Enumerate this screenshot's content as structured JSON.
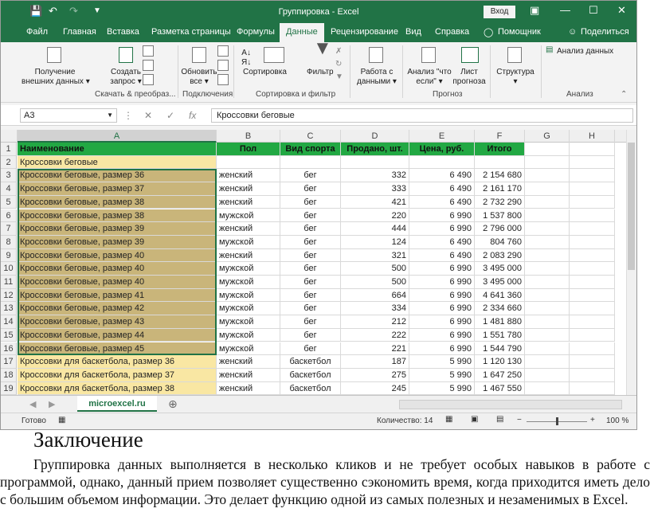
{
  "window": {
    "title": "Группировка  -  Excel",
    "sign_in": "Вход",
    "minimize": "—",
    "restore": "☐",
    "close": "✕"
  },
  "tabs": [
    "Файл",
    "Главная",
    "Вставка",
    "Разметка страницы",
    "Формулы",
    "Данные",
    "Рецензирование",
    "Вид",
    "Справка",
    "Помощник",
    "Поделиться"
  ],
  "active_tab": "Данные",
  "ribbon": {
    "get_data": [
      "Получение",
      "внешних данных ▾"
    ],
    "create_query": [
      "Создать",
      "запрос ▾"
    ],
    "refresh": [
      "Обновить",
      "все ▾"
    ],
    "sort": "Сортировка",
    "filter": "Фильтр",
    "forecast_tools": [
      "Работа с",
      "данными ▾"
    ],
    "what_if": [
      "Анализ \"что",
      "если\" ▾"
    ],
    "forecast_sheet": [
      "Лист",
      "прогноза"
    ],
    "outline": [
      "Структура",
      "▾"
    ],
    "data_analysis": "Анализ данных",
    "groups": [
      "Скачать & преобраз...",
      "Подключения",
      "Сортировка и фильтр",
      "Прогноз",
      "Анализ"
    ]
  },
  "formula_bar": {
    "name_box": "A3",
    "fx": "fx",
    "value": "Кроссовки беговые"
  },
  "columns": [
    "A",
    "B",
    "C",
    "D",
    "E",
    "F",
    "G",
    "H"
  ],
  "rows": [
    {
      "n": "1",
      "a": "Наименование",
      "b": "Пол",
      "c": "Вид спорта",
      "d": "Продано, шт.",
      "e": "Цена, руб.",
      "f": "Итого",
      "type": "header"
    },
    {
      "n": "2",
      "a": "Кроссовки беговые",
      "b": "",
      "c": "",
      "d": "",
      "e": "",
      "f": "",
      "type": "group"
    },
    {
      "n": "3",
      "a": "Кроссовки беговые, размер 36",
      "b": "женский",
      "c": "бег",
      "d": "332",
      "e": "6 490",
      "f": "2 154 680",
      "type": "sel"
    },
    {
      "n": "4",
      "a": "Кроссовки беговые, размер 37",
      "b": "женский",
      "c": "бег",
      "d": "333",
      "e": "6 490",
      "f": "2 161 170",
      "type": "sel"
    },
    {
      "n": "5",
      "a": "Кроссовки беговые, размер 38",
      "b": "женский",
      "c": "бег",
      "d": "421",
      "e": "6 490",
      "f": "2 732 290",
      "type": "sel"
    },
    {
      "n": "6",
      "a": "Кроссовки беговые, размер 38",
      "b": "мужской",
      "c": "бег",
      "d": "220",
      "e": "6 990",
      "f": "1 537 800",
      "type": "sel"
    },
    {
      "n": "7",
      "a": "Кроссовки беговые, размер 39",
      "b": "женский",
      "c": "бег",
      "d": "444",
      "e": "6 990",
      "f": "2 796 000",
      "type": "sel"
    },
    {
      "n": "8",
      "a": "Кроссовки беговые, размер 39",
      "b": "мужской",
      "c": "бег",
      "d": "124",
      "e": "6 490",
      "f": "804 760",
      "type": "sel"
    },
    {
      "n": "9",
      "a": "Кроссовки беговые, размер 40",
      "b": "женский",
      "c": "бег",
      "d": "321",
      "e": "6 490",
      "f": "2 083 290",
      "type": "sel"
    },
    {
      "n": "10",
      "a": "Кроссовки беговые, размер 40",
      "b": "мужской",
      "c": "бег",
      "d": "500",
      "e": "6 990",
      "f": "3 495 000",
      "type": "sel"
    },
    {
      "n": "11",
      "a": "Кроссовки беговые, размер 40",
      "b": "мужской",
      "c": "бег",
      "d": "500",
      "e": "6 990",
      "f": "3 495 000",
      "type": "sel"
    },
    {
      "n": "12",
      "a": "Кроссовки беговые, размер 41",
      "b": "мужской",
      "c": "бег",
      "d": "664",
      "e": "6 990",
      "f": "4 641 360",
      "type": "sel"
    },
    {
      "n": "13",
      "a": "Кроссовки беговые, размер 42",
      "b": "мужской",
      "c": "бег",
      "d": "334",
      "e": "6 990",
      "f": "2 334 660",
      "type": "sel"
    },
    {
      "n": "14",
      "a": "Кроссовки беговые, размер 43",
      "b": "мужской",
      "c": "бег",
      "d": "212",
      "e": "6 990",
      "f": "1 481 880",
      "type": "sel"
    },
    {
      "n": "15",
      "a": "Кроссовки беговые, размер 44",
      "b": "мужской",
      "c": "бег",
      "d": "222",
      "e": "6 990",
      "f": "1 551 780",
      "type": "sel"
    },
    {
      "n": "16",
      "a": "Кроссовки беговые, размер 45",
      "b": "мужской",
      "c": "бег",
      "d": "221",
      "e": "6 990",
      "f": "1 544 790",
      "type": "sel"
    },
    {
      "n": "17",
      "a": "Кроссовки для баскетбола, размер 36",
      "b": "женский",
      "c": "баскетбол",
      "d": "187",
      "e": "5 990",
      "f": "1 120 130",
      "type": "name"
    },
    {
      "n": "18",
      "a": "Кроссовки для баскетбола, размер 37",
      "b": "женский",
      "c": "баскетбол",
      "d": "275",
      "e": "5 990",
      "f": "1 647 250",
      "type": "name"
    },
    {
      "n": "19",
      "a": "Кроссовки для баскетбола, размер 38",
      "b": "женский",
      "c": "баскетбол",
      "d": "245",
      "e": "5 990",
      "f": "1 467 550",
      "type": "name"
    }
  ],
  "sheet_tab": "microexcel.ru",
  "status": {
    "ready": "Готово",
    "count": "Количество: 14",
    "zoom": "100 %"
  },
  "article": {
    "heading": "Заключение",
    "paragraph": "Группировка данных выполняется в несколько кликов и не требует особых навыков в работе с программой, однако, данный прием позволяет существенно сэкономить время, когда приходится иметь дело с большим объемом информации. Это делает функцию одной из самых полезных и незаменимых в Excel."
  },
  "colors": {
    "excel_green": "#217346",
    "header_fill": "#22a843",
    "name_fill": "#f9e7a3",
    "selected_fill": "#c9b57a"
  }
}
